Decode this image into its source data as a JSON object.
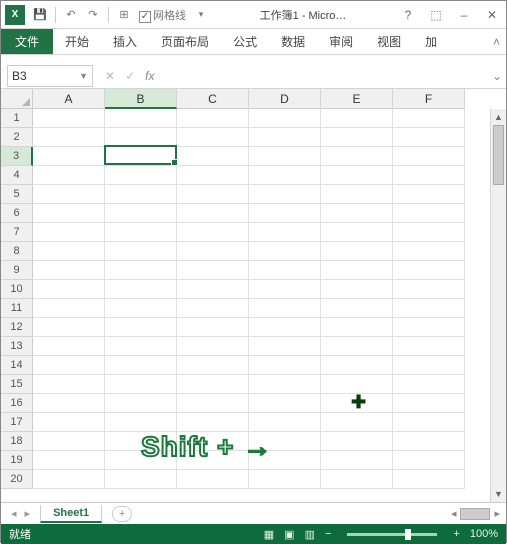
{
  "titlebar": {
    "app_icon_text": "X",
    "gridlines_label": "网格线",
    "doc_title": "工作簿1 - Micro…",
    "help": "?",
    "ribbon_display": "⬚",
    "minimize": "–",
    "close": "✕"
  },
  "qat": {
    "gridlines_checked": "✓"
  },
  "ribbon": {
    "file": "文件",
    "tabs": [
      "开始",
      "插入",
      "页面布局",
      "公式",
      "数据",
      "审阅",
      "视图",
      "加"
    ]
  },
  "formula_bar": {
    "name_box": "B3",
    "cancel": "✕",
    "enter": "✓",
    "fx": "fx",
    "formula": ""
  },
  "grid": {
    "columns": [
      "A",
      "B",
      "C",
      "D",
      "E",
      "F"
    ],
    "rows": [
      "1",
      "2",
      "3",
      "4",
      "5",
      "6",
      "7",
      "8",
      "9",
      "10",
      "11",
      "12",
      "13",
      "14",
      "15",
      "16",
      "17",
      "18",
      "19",
      "20"
    ],
    "active_col_index": 1,
    "active_row_index": 2,
    "selected_cell": "B3"
  },
  "annotation": {
    "cursor": "✚",
    "text": "Shift + →"
  },
  "sheet_tabs": {
    "active": "Sheet1",
    "add": "+"
  },
  "status": {
    "ready": "就绪",
    "zoom": "100%",
    "zoom_minus": "−",
    "zoom_plus": "+"
  }
}
